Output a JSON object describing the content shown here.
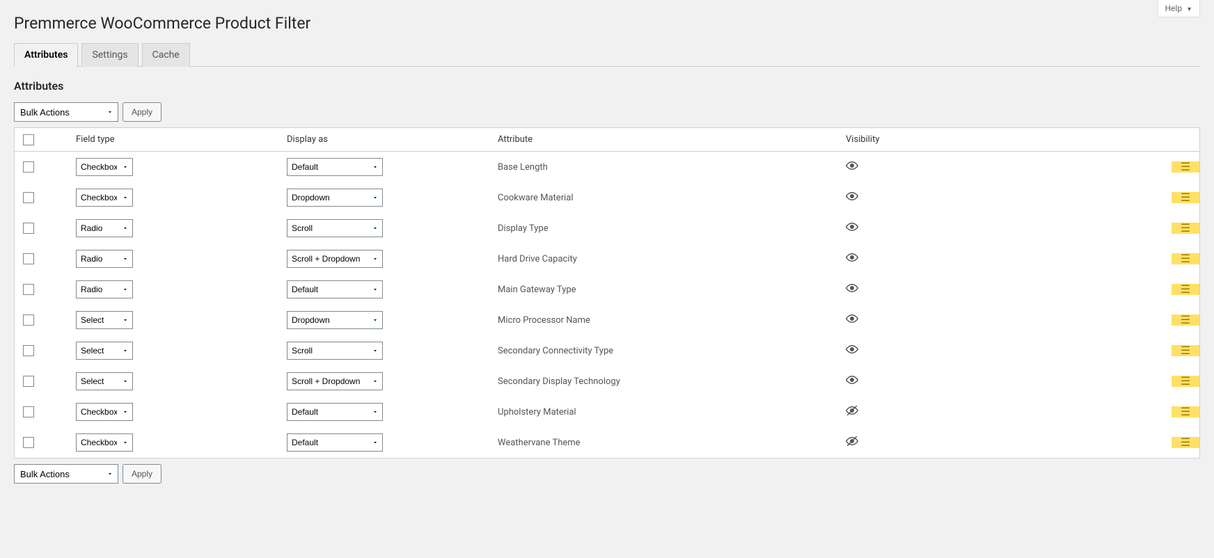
{
  "help": {
    "label": "Help"
  },
  "page": {
    "title": "Premmerce WooCommerce Product Filter"
  },
  "tabs": [
    {
      "label": "Attributes",
      "active": true
    },
    {
      "label": "Settings",
      "active": false
    },
    {
      "label": "Cache",
      "active": false
    }
  ],
  "section": {
    "title": "Attributes"
  },
  "bulk": {
    "select_label": "Bulk Actions",
    "apply_label": "Apply"
  },
  "columns": {
    "field_type": "Field type",
    "display_as": "Display as",
    "attribute": "Attribute",
    "visibility": "Visibility"
  },
  "field_type_options": [
    "Checkbox",
    "Radio",
    "Select"
  ],
  "display_as_options": [
    "Default",
    "Dropdown",
    "Scroll",
    "Scroll + Dropdown"
  ],
  "rows": [
    {
      "field_type": "Checkbox",
      "display_as": "Default",
      "attribute": "Base Length",
      "visible": true
    },
    {
      "field_type": "Checkbox",
      "display_as": "Dropdown",
      "attribute": "Cookware Material",
      "visible": true
    },
    {
      "field_type": "Radio",
      "display_as": "Scroll",
      "attribute": "Display Type",
      "visible": true
    },
    {
      "field_type": "Radio",
      "display_as": "Scroll + Dropdown",
      "attribute": "Hard Drive Capacity",
      "visible": true
    },
    {
      "field_type": "Radio",
      "display_as": "Default",
      "attribute": "Main Gateway Type",
      "visible": true
    },
    {
      "field_type": "Select",
      "display_as": "Dropdown",
      "attribute": "Micro Processor Name",
      "visible": true
    },
    {
      "field_type": "Select",
      "display_as": "Scroll",
      "attribute": "Secondary Connectivity Type",
      "visible": true
    },
    {
      "field_type": "Select",
      "display_as": "Scroll + Dropdown",
      "attribute": "Secondary Display Technology",
      "visible": true
    },
    {
      "field_type": "Checkbox",
      "display_as": "Default",
      "attribute": "Upholstery Material",
      "visible": false
    },
    {
      "field_type": "Checkbox",
      "display_as": "Default",
      "attribute": "Weathervane Theme",
      "visible": false
    }
  ]
}
